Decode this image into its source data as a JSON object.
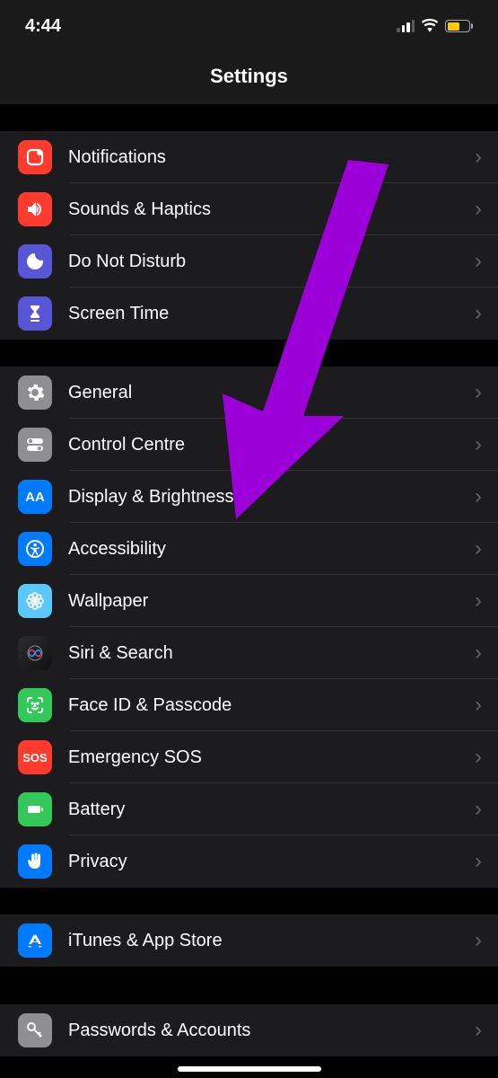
{
  "status": {
    "time": "4:44"
  },
  "header": {
    "title": "Settings"
  },
  "sections": [
    {
      "items": [
        {
          "id": "notifications",
          "label": "Notifications"
        },
        {
          "id": "sounds",
          "label": "Sounds & Haptics"
        },
        {
          "id": "dnd",
          "label": "Do Not Disturb"
        },
        {
          "id": "screentime",
          "label": "Screen Time"
        }
      ]
    },
    {
      "items": [
        {
          "id": "general",
          "label": "General"
        },
        {
          "id": "controlcentre",
          "label": "Control Centre"
        },
        {
          "id": "display",
          "label": "Display & Brightness"
        },
        {
          "id": "accessibility",
          "label": "Accessibility"
        },
        {
          "id": "wallpaper",
          "label": "Wallpaper"
        },
        {
          "id": "siri",
          "label": "Siri & Search"
        },
        {
          "id": "faceid",
          "label": "Face ID & Passcode"
        },
        {
          "id": "sos",
          "label": "Emergency SOS",
          "glyph": "SOS"
        },
        {
          "id": "battery",
          "label": "Battery"
        },
        {
          "id": "privacy",
          "label": "Privacy"
        }
      ]
    },
    {
      "items": [
        {
          "id": "itunes",
          "label": "iTunes & App Store"
        }
      ]
    },
    {
      "items": [
        {
          "id": "passwords",
          "label": "Passwords & Accounts"
        }
      ]
    }
  ],
  "annotation": {
    "arrow_target": "display",
    "arrow_color": "#9b00d9"
  }
}
